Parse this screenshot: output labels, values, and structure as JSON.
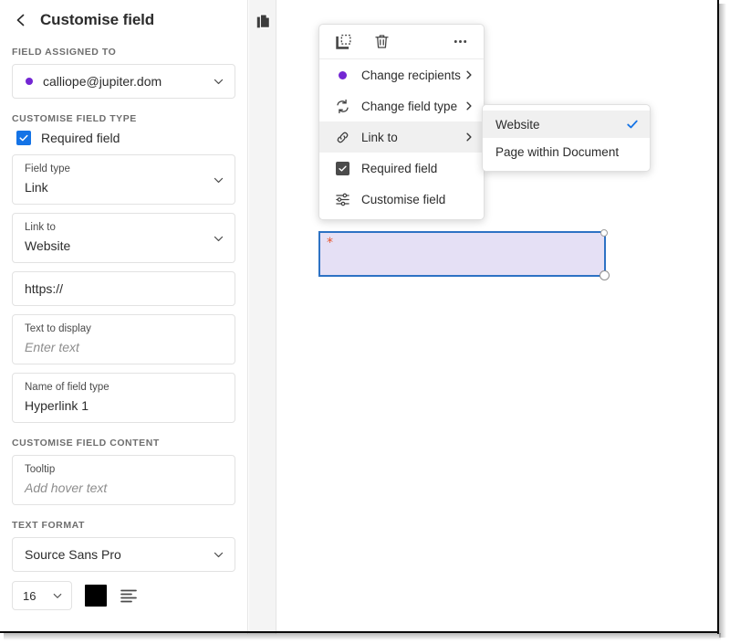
{
  "sidebar": {
    "back_icon": "chevron-left-icon",
    "title": "Customise field",
    "sections": {
      "assigned_label": "FIELD ASSIGNED TO",
      "assigned_value": "calliope@jupiter.dom",
      "assigned_dot_color": "#7326d3",
      "customise_type_label": "CUSTOMISE FIELD TYPE",
      "required_checkbox_label": "Required field",
      "required_checkbox_checked": true,
      "required_checkbox_color": "#1473e6",
      "customise_content_label": "CUSTOMISE FIELD CONTENT",
      "text_format_label": "TEXT FORMAT"
    },
    "fields": [
      {
        "label": "Field type",
        "value": "Link",
        "type": "select"
      },
      {
        "label": "Link to",
        "value": "Website",
        "type": "select"
      },
      {
        "label": "",
        "value": "https://",
        "type": "text"
      },
      {
        "label": "Text to display",
        "value": "Enter text",
        "type": "text-placeholder"
      },
      {
        "label": "Name of field type",
        "value": "Hyperlink 1",
        "type": "text"
      },
      {
        "label": "Tooltip",
        "value": "Add hover text",
        "type": "text-placeholder"
      }
    ],
    "text_format": {
      "font_family": "Source Sans Pro",
      "font_size": "16",
      "text_color": "#000000",
      "align_icon": "text-align-left-icon"
    }
  },
  "thumbnail_panel": {
    "icon": "page-thumbnails-icon"
  },
  "context_menu": {
    "toolbar": [
      {
        "name": "duplicate-field-icon",
        "label": "Duplicate field"
      },
      {
        "name": "delete-field-icon",
        "label": "Delete field"
      },
      {
        "name": "more-options-icon",
        "label": "More options"
      }
    ],
    "items": [
      {
        "label": "Change recipients",
        "icon": "recipient-dot-icon",
        "submenu": true,
        "highlighted": false,
        "checked": false
      },
      {
        "label": "Change field type",
        "icon": "refresh-icon",
        "submenu": true,
        "highlighted": false,
        "checked": false
      },
      {
        "label": "Link to",
        "icon": "link-icon",
        "submenu": true,
        "highlighted": true,
        "checked": false
      },
      {
        "label": "Required field",
        "icon": "checkbox-checked-icon",
        "submenu": false,
        "highlighted": false,
        "checked": true
      },
      {
        "label": "Customise field",
        "icon": "sliders-icon",
        "submenu": false,
        "highlighted": false,
        "checked": false
      }
    ]
  },
  "submenu": {
    "items": [
      {
        "label": "Website",
        "selected": true,
        "highlighted": true
      },
      {
        "label": "Page within Document",
        "selected": false,
        "highlighted": false
      }
    ],
    "check_color": "#1473e6"
  },
  "page_field": {
    "required_marker": "*",
    "required_marker_color": "#e8552c",
    "fill_color": "#e5e0f5",
    "border_color": "#2d72c4"
  }
}
